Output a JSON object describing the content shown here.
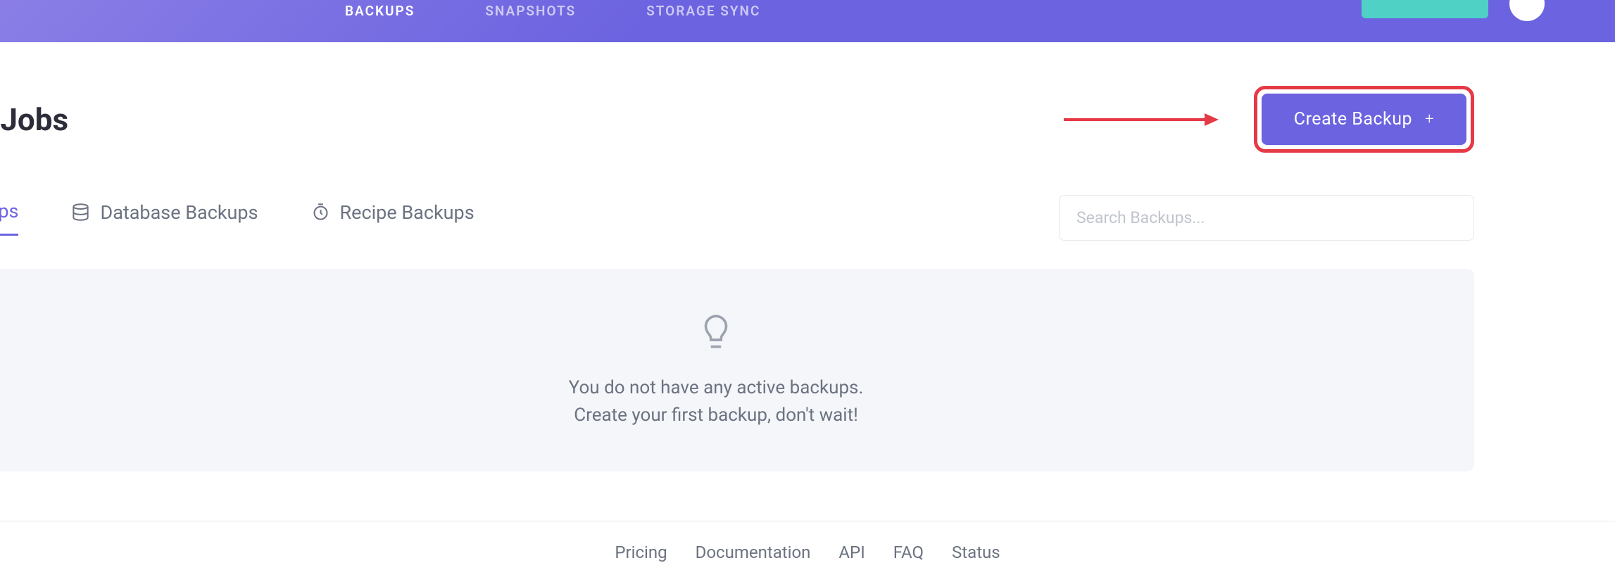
{
  "nav": {
    "items": [
      {
        "label": "BACKUPS",
        "active": true
      },
      {
        "label": "SNAPSHOTS",
        "active": false
      },
      {
        "label": "STORAGE SYNC",
        "active": false
      }
    ]
  },
  "page": {
    "title": "up Jobs",
    "create_button": "Create Backup"
  },
  "tabs": {
    "items": [
      {
        "label": "ackups",
        "active": true
      },
      {
        "label": "Database Backups",
        "active": false
      },
      {
        "label": "Recipe Backups",
        "active": false
      }
    ]
  },
  "search": {
    "placeholder": "Search Backups..."
  },
  "empty": {
    "line1": "You do not have any active backups.",
    "line2": "Create your first backup, don't wait!"
  },
  "footer": {
    "links": [
      "Pricing",
      "Documentation",
      "API",
      "FAQ",
      "Status"
    ]
  }
}
